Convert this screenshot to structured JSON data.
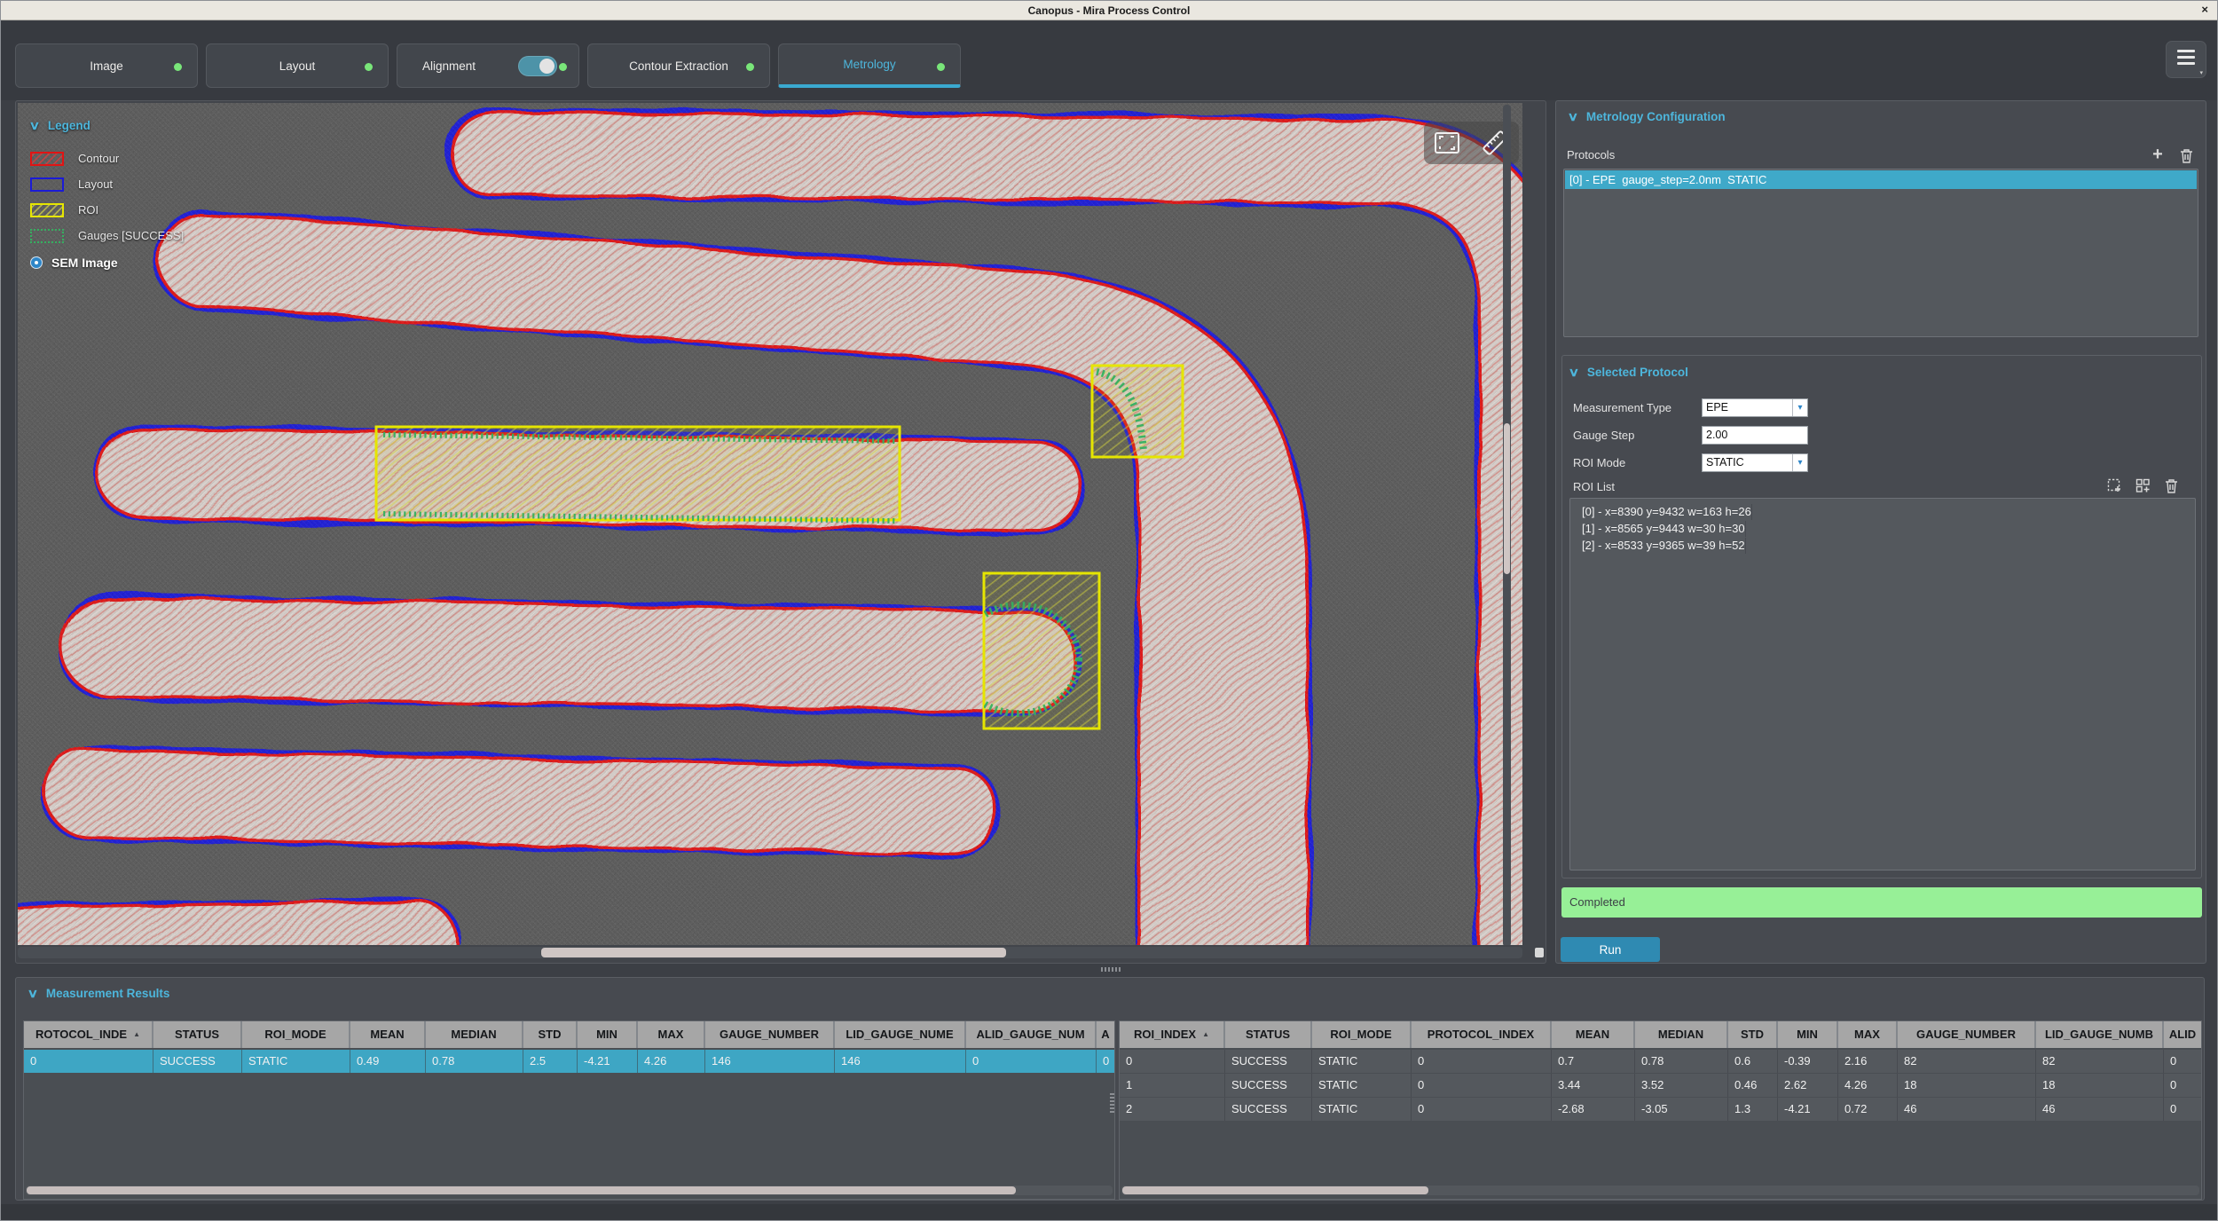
{
  "window": {
    "title": "Canopus - Mira Process Control",
    "close": "×"
  },
  "tabs": [
    {
      "label": "Image"
    },
    {
      "label": "Layout"
    },
    {
      "label": "Alignment"
    },
    {
      "label": "Contour Extraction"
    },
    {
      "label": "Metrology"
    }
  ],
  "viewer": {
    "legend": {
      "title": "Legend",
      "items": [
        {
          "label": "Contour"
        },
        {
          "label": "Layout"
        },
        {
          "label": "ROI"
        },
        {
          "label": "Gauges [SUCCESS]"
        }
      ],
      "sem_label": "SEM Image"
    }
  },
  "config": {
    "title": "Metrology Configuration",
    "protocols_label": "Protocols",
    "protocol_item": "[0] - EPE  gauge_step=2.0nm  STATIC"
  },
  "selected_protocol": {
    "title": "Selected Protocol",
    "measurement_type_label": "Measurement Type",
    "measurement_type_value": "EPE",
    "gauge_step_label": "Gauge Step",
    "gauge_step_value": "2.00",
    "roi_mode_label": "ROI Mode",
    "roi_mode_value": "STATIC",
    "roi_list_label": "ROI List",
    "roi_items": [
      "[0] - x=8390 y=9432 w=163 h=26",
      "[1] - x=8565 y=9443 w=30 h=30",
      "[2] - x=8533 y=9365 w=39 h=52"
    ]
  },
  "status": {
    "text": "Completed",
    "color": "#97f097"
  },
  "run_label": "Run",
  "results": {
    "title": "Measurement Results",
    "left_table": {
      "columns": [
        "ROTOCOL_INDE",
        "STATUS",
        "ROI_MODE",
        "MEAN",
        "MEDIAN",
        "STD",
        "MIN",
        "MAX",
        "GAUGE_NUMBER",
        "LID_GAUGE_NUME",
        "ALID_GAUGE_NUM",
        "A"
      ],
      "rows": [
        [
          "0",
          "SUCCESS",
          "STATIC",
          "0.49",
          "0.78",
          "2.5",
          "-4.21",
          "4.26",
          "146",
          "146",
          "0",
          "0"
        ]
      ]
    },
    "right_table": {
      "columns": [
        "ROI_INDEX",
        "STATUS",
        "ROI_MODE",
        "PROTOCOL_INDEX",
        "MEAN",
        "MEDIAN",
        "STD",
        "MIN",
        "MAX",
        "GAUGE_NUMBER",
        "LID_GAUGE_NUMB",
        "ALID"
      ],
      "rows": [
        [
          "0",
          "SUCCESS",
          "STATIC",
          "0",
          "0.7",
          "0.78",
          "0.6",
          "-0.39",
          "2.16",
          "82",
          "82",
          "0"
        ],
        [
          "1",
          "SUCCESS",
          "STATIC",
          "0",
          "3.44",
          "3.52",
          "0.46",
          "2.62",
          "4.26",
          "18",
          "18",
          "0"
        ],
        [
          "2",
          "SUCCESS",
          "STATIC",
          "0",
          "-2.68",
          "-3.05",
          "1.3",
          "-4.21",
          "0.72",
          "46",
          "46",
          "0"
        ]
      ]
    }
  },
  "colors": {
    "accent_cyan": "#4db6dc",
    "selection": "#3ea6c4",
    "status_green": "#97f097",
    "ok_dot": "#79e679",
    "contour_red": "#e01414",
    "layout_blue": "#1b1bd6",
    "roi_yellow": "#e6e600",
    "gauge_green": "#35b060"
  }
}
